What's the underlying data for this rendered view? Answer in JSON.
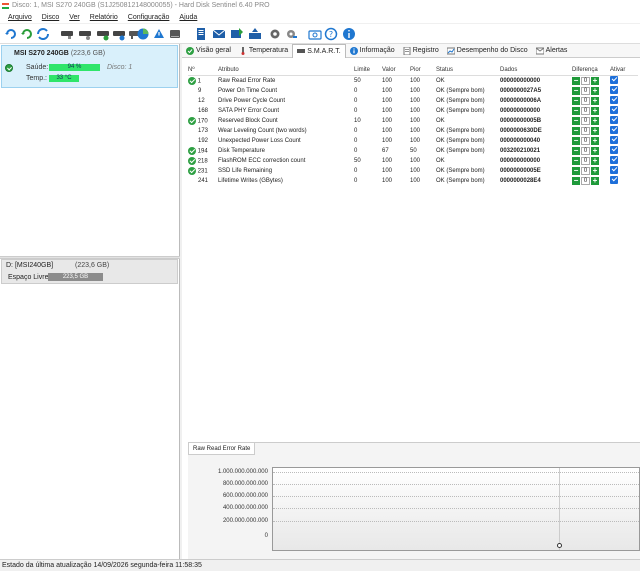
{
  "window": {
    "title": "Disco: 1, MSI S270 240GB (S1J250812148000055) - Hard Disk Sentinel 6.40 PRO"
  },
  "menu": [
    "Arquivo",
    "Disco",
    "Ver",
    "Relatório",
    "Configuração",
    "Ajuda"
  ],
  "disk": {
    "name": "MSI S270 240GB",
    "size": "(223,6 GB)",
    "disk_label": "Disco: 1",
    "health_label": "Saúde:",
    "health_value": "94 %",
    "health_pct": 94,
    "temp_label": "Temp.:",
    "temp_value": "33 °C",
    "temp_pct": 55,
    "accent_color": "#2fe56a"
  },
  "volume": {
    "name": "D: [MSI240GB]",
    "size": "(223,6 GB)",
    "free_label": "Espaço Livre",
    "free_value": "223,5 GB"
  },
  "tabs": [
    "Visão geral",
    "Temperatura",
    "S.M.A.R.T.",
    "Informação",
    "Registro",
    "Desempenho do Disco",
    "Alertas"
  ],
  "table": {
    "headers": [
      "Nº",
      "Atributo",
      "Limite",
      "Valor",
      "Pior",
      "Status",
      "Dados",
      "Diferença",
      "Ativar"
    ],
    "rows": [
      {
        "id": "1",
        "attr": "Raw Read Error Rate",
        "limit": "50",
        "value": "100",
        "worst": "100",
        "status": "OK",
        "data": "000000000000",
        "diff": "0",
        "ok": true
      },
      {
        "id": "9",
        "attr": "Power On Time Count",
        "limit": "0",
        "value": "100",
        "worst": "100",
        "status": "OK (Sempre bom)",
        "data": "0000000027A5",
        "diff": "0",
        "ok": false
      },
      {
        "id": "12",
        "attr": "Drive Power Cycle Count",
        "limit": "0",
        "value": "100",
        "worst": "100",
        "status": "OK (Sempre bom)",
        "data": "00000000006A",
        "diff": "0",
        "ok": false
      },
      {
        "id": "168",
        "attr": "SATA PHY Error Count",
        "limit": "0",
        "value": "100",
        "worst": "100",
        "status": "OK (Sempre bom)",
        "data": "000000000000",
        "diff": "0",
        "ok": false
      },
      {
        "id": "170",
        "attr": "Reserved Block Count",
        "limit": "10",
        "value": "100",
        "worst": "100",
        "status": "OK",
        "data": "00000000005B",
        "diff": "0",
        "ok": true
      },
      {
        "id": "173",
        "attr": "Wear Leveling Count (two words)",
        "limit": "0",
        "value": "100",
        "worst": "100",
        "status": "OK (Sempre bom)",
        "data": "0000000630DE",
        "diff": "0",
        "ok": false
      },
      {
        "id": "192",
        "attr": "Unexpected Power Loss Count",
        "limit": "0",
        "value": "100",
        "worst": "100",
        "status": "OK (Sempre bom)",
        "data": "000000000040",
        "diff": "0",
        "ok": false
      },
      {
        "id": "194",
        "attr": "Disk Temperature",
        "limit": "0",
        "value": "67",
        "worst": "50",
        "status": "OK (Sempre bom)",
        "data": "003200210021",
        "diff": "0",
        "ok": true
      },
      {
        "id": "218",
        "attr": "FlashROM ECC correction count",
        "limit": "50",
        "value": "100",
        "worst": "100",
        "status": "OK",
        "data": "000000000000",
        "diff": "0",
        "ok": true
      },
      {
        "id": "231",
        "attr": "SSD Life Remaining",
        "limit": "0",
        "value": "100",
        "worst": "100",
        "status": "OK (Sempre bom)",
        "data": "00000000005E",
        "diff": "0",
        "ok": true
      },
      {
        "id": "241",
        "attr": "Lifetime Writes (GBytes)",
        "limit": "0",
        "value": "100",
        "worst": "100",
        "status": "OK (Sempre bom)",
        "data": "0000000028E4",
        "diff": "0",
        "ok": false
      }
    ]
  },
  "graph": {
    "tab_label": "Raw Read Error Rate",
    "y_labels": [
      "1.000.000.000.000",
      "800.000.000.000",
      "600.000.000.000",
      "400.000.000.000",
      "200.000.000.000",
      "0"
    ]
  },
  "status": "Estado da última atualização 14/09/2026 segunda-feira 11:58:35"
}
